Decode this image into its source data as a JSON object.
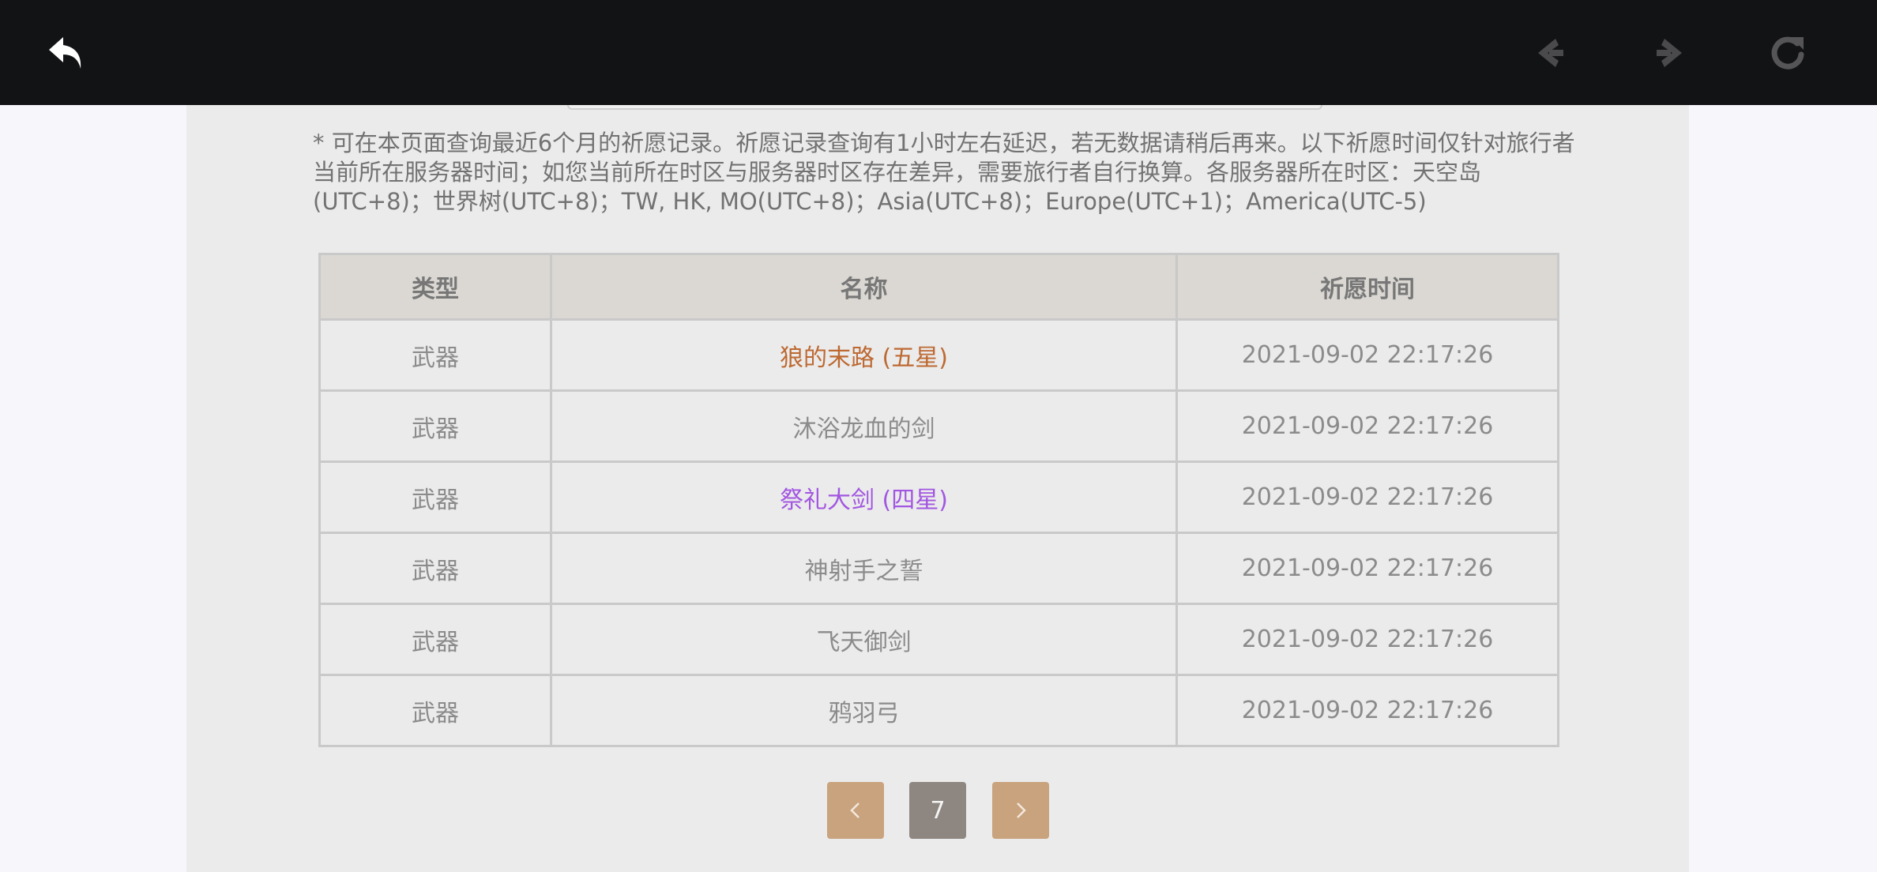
{
  "toolbar": {
    "back_icon": "back-arrow-icon",
    "nav_back_icon": "nav-back-icon",
    "nav_forward_icon": "nav-forward-icon",
    "refresh_icon": "refresh-icon"
  },
  "notice": {
    "text": "* 可在本页面查询最近6个月的祈愿记录。祈愿记录查询有1小时左右延迟，若无数据请稍后再来。以下祈愿时间仅针对旅行者当前所在服务器时间；如您当前所在时区与服务器时区存在差异，需要旅行者自行换算。各服务器所在时区：天空岛(UTC+8)；世界树(UTC+8)；TW, HK, MO(UTC+8)；Asia(UTC+8)；Europe(UTC+1)；America(UTC-5)"
  },
  "table": {
    "headers": [
      "类型",
      "名称",
      "祈愿时间"
    ],
    "rows": [
      {
        "type": "武器",
        "name": "狼的末路 (五星)",
        "time": "2021-09-02 22:17:26"
      },
      {
        "type": "武器",
        "name": "沐浴龙血的剑",
        "time": "2021-09-02 22:17:26"
      },
      {
        "type": "武器",
        "name": "祭礼大剑 (四星)",
        "time": "2021-09-02 22:17:26"
      },
      {
        "type": "武器",
        "name": "神射手之誓",
        "time": "2021-09-02 22:17:26"
      },
      {
        "type": "武器",
        "name": "飞天御剑",
        "time": "2021-09-02 22:17:26"
      },
      {
        "type": "武器",
        "name": "鸦羽弓",
        "time": "2021-09-02 22:17:26"
      }
    ]
  },
  "pagination": {
    "current_page": "7",
    "prev_icon": "chevron-left-icon",
    "next_icon": "chevron-right-icon"
  },
  "colors": {
    "five_star": "#bd6932",
    "four_star": "#a256e1",
    "pager_accent": "#c9a27e",
    "pager_current": "#8e8781",
    "topbar": "#121315"
  }
}
